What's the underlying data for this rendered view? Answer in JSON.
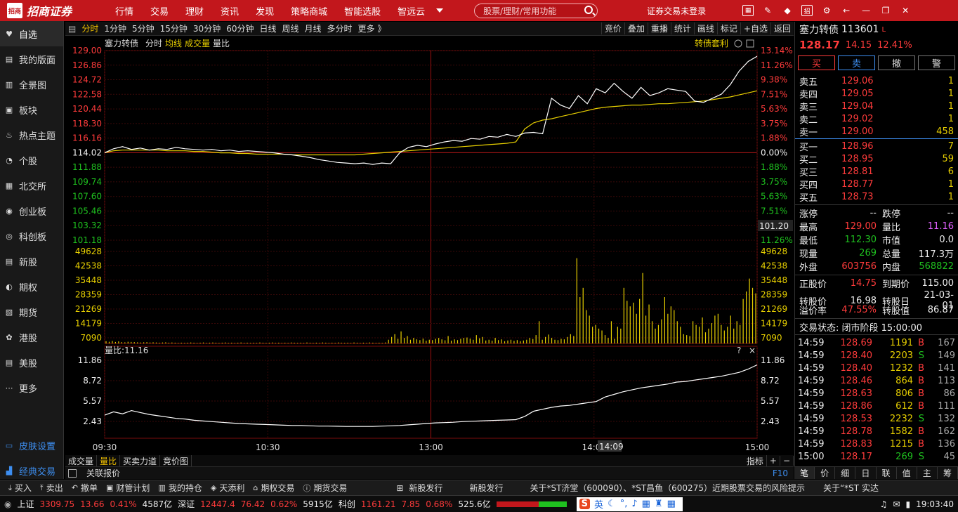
{
  "topbar": {
    "logo_mark": "招商\n证券",
    "logo_text": "招商证券",
    "nav": [
      "行情",
      "交易",
      "理财",
      "资讯",
      "发现",
      "策略商城",
      "智能选股",
      "智远云"
    ],
    "search_placeholder": "股票/理财/常用功能",
    "login_status": "证券交易未登录"
  },
  "sidebar": {
    "items": [
      {
        "label": "自选",
        "icon": "heart-icon"
      },
      {
        "label": "我的版面",
        "icon": "layout-icon"
      },
      {
        "label": "全景图",
        "icon": "panorama-icon"
      },
      {
        "label": "板块",
        "icon": "sector-icon"
      },
      {
        "label": "热点主题",
        "icon": "fire-icon"
      },
      {
        "label": "个股",
        "icon": "stock-icon"
      },
      {
        "label": "北交所",
        "icon": "beijing-exchange-icon"
      },
      {
        "label": "创业板",
        "icon": "chinext-icon"
      },
      {
        "label": "科创板",
        "icon": "star-market-icon"
      },
      {
        "label": "新股",
        "icon": "ipo-icon"
      },
      {
        "label": "期权",
        "icon": "options-icon"
      },
      {
        "label": "期货",
        "icon": "futures-icon"
      },
      {
        "label": "港股",
        "icon": "hk-stock-icon"
      },
      {
        "label": "美股",
        "icon": "us-stock-icon"
      },
      {
        "label": "更多",
        "icon": "more-icon"
      }
    ],
    "skin": "皮肤设置",
    "classic": "经典交易"
  },
  "periodbar": {
    "periods": [
      "分时",
      "1分钟",
      "5分钟",
      "15分钟",
      "30分钟",
      "60分钟",
      "日线",
      "周线",
      "月线",
      "多分时",
      "更多 》"
    ],
    "actions": [
      "竞价",
      "叠加",
      "重播",
      "统计",
      "画线",
      "标记",
      "+自选",
      "返回"
    ]
  },
  "chart_header": {
    "name": "塞力转债",
    "mode": "分时",
    "avg": "均线",
    "vol": "成交量",
    "ratio": "量比",
    "arbitrage": "转债套利",
    "ratio_label": "量比:11.16",
    "price_tag": "101.20",
    "time_tag": "14:09"
  },
  "chart_data": {
    "type": "line",
    "price_axis_left": [
      "129.00",
      "126.86",
      "124.72",
      "122.58",
      "120.44",
      "118.30",
      "116.16",
      "114.02",
      "111.88",
      "109.74",
      "107.60",
      "105.46",
      "103.32",
      "101.18"
    ],
    "pct_axis_right": [
      "13.14%",
      "11.26%",
      "9.38%",
      "7.51%",
      "5.63%",
      "3.75%",
      "1.88%",
      "0.00%",
      "1.88%",
      "3.75%",
      "5.63%",
      "7.51%",
      "9.38%",
      "11.26%"
    ],
    "volume_axis": [
      "49628",
      "42538",
      "35448",
      "28359",
      "21269",
      "14179",
      "7090"
    ],
    "ratio_axis": [
      "11.86",
      "8.72",
      "5.57",
      "2.43"
    ],
    "time_axis": [
      "09:30",
      "10:30",
      "13:00",
      "14:00",
      "15:00"
    ],
    "price_range": [
      99.04,
      129.0
    ],
    "prev_close": 114.02,
    "price_series": [
      114.02,
      114.6,
      114.9,
      114.5,
      114.7,
      114.4,
      114.6,
      114.5,
      114.8,
      114.6,
      114.5,
      114.4,
      114.5,
      114.3,
      114.4,
      114.2,
      114.3,
      114.2,
      114.1,
      114.0,
      113.8,
      113.7,
      113.5,
      113.3,
      113.0,
      112.8,
      112.6,
      112.5,
      112.4,
      112.5,
      112.3,
      112.5,
      112.4,
      114.0,
      114.8,
      115.1,
      114.9,
      115.3,
      115.6,
      115.8,
      115.7,
      116.1,
      116.0,
      116.4,
      116.3,
      116.7,
      116.4,
      116.9,
      117.0,
      116.8,
      122.0,
      121.0,
      120.5,
      122.4,
      121.2,
      123.4,
      122.8,
      124.2,
      123.0,
      122.0,
      123.6,
      122.4,
      122.8,
      123.4,
      123.2,
      123.0,
      121.6,
      121.4,
      122.0,
      122.6,
      124.0,
      126.0,
      127.4,
      128.17
    ],
    "avg_series": [
      114.02,
      114.3,
      114.4,
      114.4,
      114.4,
      114.4,
      114.4,
      114.3,
      114.3,
      114.3,
      114.2,
      114.2,
      114.1,
      114.0,
      114.0,
      113.9,
      113.9,
      113.8,
      113.8,
      113.8,
      113.8,
      113.7,
      113.7,
      113.7,
      113.7,
      113.7,
      113.7,
      113.7,
      113.7,
      113.8,
      113.9,
      114.0,
      114.1,
      114.2,
      114.3,
      114.4,
      114.5,
      114.6,
      114.7,
      114.8,
      114.9,
      115.0,
      115.1,
      115.2,
      115.3,
      115.4,
      115.6,
      117.5,
      118.4,
      118.8,
      119.0,
      119.3,
      119.6,
      119.9,
      120.2,
      120.5,
      120.7,
      120.8,
      120.9,
      121.0,
      121.0,
      121.1,
      121.2,
      121.2,
      121.3,
      121.4,
      121.5,
      121.6,
      121.8,
      122.0,
      122.2,
      122.5,
      122.8,
      123.1
    ],
    "volume_max": 49628,
    "volume_series": [
      1200,
      900,
      1300,
      800,
      1100,
      700,
      600,
      900,
      800,
      700,
      600,
      500,
      600,
      700,
      500,
      600,
      500,
      400,
      500,
      600,
      400,
      500,
      400,
      300,
      400,
      300,
      400,
      500,
      400,
      300,
      400,
      500,
      300,
      400,
      500,
      400,
      300,
      400,
      500,
      300,
      400,
      300,
      400,
      500,
      300,
      400,
      300,
      400,
      300,
      500,
      400,
      300,
      400,
      500,
      300,
      400,
      300,
      400,
      300,
      500,
      400,
      300,
      400,
      300,
      500,
      400,
      300,
      400,
      300,
      500,
      400,
      300,
      400,
      300,
      500,
      400,
      300,
      400,
      300,
      500,
      400,
      300,
      400,
      300,
      500,
      400,
      300,
      400,
      300,
      500,
      2000,
      3500,
      5000,
      2500,
      6500,
      3000,
      4000,
      2000,
      3000,
      2200,
      1800,
      2600,
      1500,
      2000,
      1800,
      2500,
      3000,
      2200,
      1700,
      4000,
      1500,
      2200,
      1800,
      2500,
      3000,
      3200,
      2600,
      2000,
      4500,
      2800,
      3500,
      1600,
      2000,
      1500,
      3000,
      1800,
      2200,
      1200,
      1600,
      2000,
      1400,
      1800,
      1200,
      1600,
      2000,
      3000,
      2400,
      4500,
      12000,
      2000,
      3500,
      4800,
      3000,
      2000,
      1800,
      2500,
      2200,
      3500,
      5000,
      4000,
      46000,
      25000,
      30000,
      18000,
      15000,
      9000,
      10000,
      8000,
      7000,
      4500,
      3000,
      12000,
      2500,
      9000,
      8000,
      30000,
      23000,
      20000,
      22000,
      16000,
      24000,
      38000,
      15000,
      21000,
      12000,
      8000,
      10000,
      13000,
      25000,
      16000,
      20000,
      18000,
      12000,
      9000,
      5000,
      4500,
      4000,
      12000,
      10000,
      9000,
      14000,
      6000,
      8000,
      11000,
      15000,
      16000,
      10000,
      7000,
      9000,
      15000,
      8000,
      12000,
      10000,
      24000,
      28000,
      35000,
      30000,
      27000
    ],
    "ratio_series": [
      3.4,
      3.9,
      3.6,
      4.1,
      3.8,
      3.5,
      3.3,
      3.1,
      2.9,
      2.8,
      2.6,
      2.5,
      2.4,
      2.3,
      2.2,
      2.1,
      2.05,
      2.0,
      1.95,
      1.9,
      1.85,
      1.8,
      1.8,
      1.75,
      1.7,
      1.7,
      1.68,
      1.65,
      1.65,
      1.65,
      1.65,
      1.7,
      1.75,
      1.8,
      1.9,
      2.0,
      2.1,
      2.2,
      2.25,
      2.3,
      2.4,
      2.45,
      2.5,
      2.55,
      2.6,
      2.65,
      2.7,
      3.2,
      4.0,
      4.3,
      4.6,
      4.8,
      4.9,
      5.1,
      5.3,
      5.5,
      6.2,
      6.6,
      7.0,
      7.3,
      7.6,
      7.8,
      8.0,
      8.2,
      8.5,
      8.6,
      8.8,
      9.0,
      9.2,
      9.4,
      9.7,
      10.0,
      10.5,
      11.16
    ]
  },
  "subtabs": [
    "成交量",
    "量比",
    "买卖力道",
    "竞价图"
  ],
  "linkbar": {
    "label": "关联报价",
    "key": "F10",
    "chart_controls": [
      "指标",
      "+",
      "−"
    ]
  },
  "quote": {
    "name": "塞力转债",
    "code": "113601",
    "flag": "L",
    "price": "128.17",
    "change": "14.15",
    "pct": "12.41%",
    "buttons": [
      "买",
      "卖",
      "撤",
      "警"
    ],
    "asks": [
      {
        "label": "卖五",
        "price": "129.06",
        "vol": "1"
      },
      {
        "label": "卖四",
        "price": "129.05",
        "vol": "1"
      },
      {
        "label": "卖三",
        "price": "129.04",
        "vol": "1"
      },
      {
        "label": "卖二",
        "price": "129.02",
        "vol": "1"
      },
      {
        "label": "卖一",
        "price": "129.00",
        "vol": "458"
      }
    ],
    "bids": [
      {
        "label": "买一",
        "price": "128.96",
        "vol": "7"
      },
      {
        "label": "买二",
        "price": "128.95",
        "vol": "59"
      },
      {
        "label": "买三",
        "price": "128.81",
        "vol": "6"
      },
      {
        "label": "买四",
        "price": "128.77",
        "vol": "1"
      },
      {
        "label": "买五",
        "price": "128.73",
        "vol": "1"
      }
    ],
    "stats": [
      {
        "l1": "涨停",
        "v1": "--",
        "c1": "white",
        "l2": "跌停",
        "v2": "--",
        "c2": "white"
      },
      {
        "l1": "最高",
        "v1": "129.00",
        "c1": "red",
        "l2": "量比",
        "v2": "11.16",
        "c2": "magenta"
      },
      {
        "l1": "最低",
        "v1": "112.30",
        "c1": "green",
        "l2": "市值",
        "v2": "0.0",
        "c2": "white"
      },
      {
        "l1": "现量",
        "v1": "269",
        "c1": "green",
        "l2": "总量",
        "v2": "117.3万",
        "c2": "white"
      },
      {
        "l1": "外盘",
        "v1": "603756",
        "c1": "red",
        "l2": "内盘",
        "v2": "568822",
        "c2": "green"
      }
    ],
    "bond": [
      {
        "l1": "正股价",
        "v1": "14.75",
        "c1": "red",
        "l2": "到期价",
        "v2": "115.00",
        "c2": "white"
      },
      {
        "l1": "转股价",
        "v1": "16.98",
        "c1": "white",
        "l2": "转股日",
        "v2": "21-03-01",
        "c2": "white"
      },
      {
        "l1": "溢价率",
        "v1": "47.55%",
        "c1": "red",
        "l2": "转股值",
        "v2": "86.87",
        "c2": "white"
      }
    ],
    "status": "交易状态: 闭市阶段 15:00:00",
    "ticks": [
      {
        "t": "14:59",
        "p": "128.69",
        "v": "1191",
        "s": "B",
        "n": "167",
        "pc": "red",
        "vc": "yellow",
        "sc": "red"
      },
      {
        "t": "14:59",
        "p": "128.40",
        "v": "2203",
        "s": "S",
        "n": "149",
        "pc": "red",
        "vc": "yellow",
        "sc": "green"
      },
      {
        "t": "14:59",
        "p": "128.40",
        "v": "1232",
        "s": "B",
        "n": "141",
        "pc": "red",
        "vc": "yellow",
        "sc": "red"
      },
      {
        "t": "14:59",
        "p": "128.46",
        "v": "864",
        "s": "B",
        "n": "113",
        "pc": "red",
        "vc": "yellow",
        "sc": "red"
      },
      {
        "t": "14:59",
        "p": "128.63",
        "v": "806",
        "s": "B",
        "n": "86",
        "pc": "red",
        "vc": "yellow",
        "sc": "red"
      },
      {
        "t": "14:59",
        "p": "128.86",
        "v": "612",
        "s": "B",
        "n": "111",
        "pc": "red",
        "vc": "yellow",
        "sc": "red"
      },
      {
        "t": "14:59",
        "p": "128.53",
        "v": "2232",
        "s": "S",
        "n": "132",
        "pc": "red",
        "vc": "yellow",
        "sc": "green"
      },
      {
        "t": "14:59",
        "p": "128.78",
        "v": "1582",
        "s": "B",
        "n": "162",
        "pc": "red",
        "vc": "yellow",
        "sc": "red"
      },
      {
        "t": "14:59",
        "p": "128.83",
        "v": "1215",
        "s": "B",
        "n": "136",
        "pc": "red",
        "vc": "yellow",
        "sc": "red"
      },
      {
        "t": "15:00",
        "p": "128.17",
        "v": "269",
        "s": "S",
        "n": "45",
        "pc": "red",
        "vc": "green",
        "sc": "green"
      }
    ],
    "tabs": [
      "笔",
      "价",
      "细",
      "日",
      "联",
      "值",
      "主",
      "筹"
    ]
  },
  "tradebar": {
    "buttons": [
      "买入",
      "卖出",
      "撤单",
      "财管计划",
      "我的持仓",
      "天添利",
      "期权交易",
      "期货交易"
    ],
    "news": [
      "新股发行",
      "新股发行",
      "关于*ST济堂（600090）、*ST昌鱼（600275）近期股票交易的风险提示",
      "关于“*ST 实达"
    ]
  },
  "indexbar": {
    "sh_label": "上证",
    "sh_val": "3309.75",
    "sh_chg": "13.66",
    "sh_pct": "0.41%",
    "sh_amt": "4587亿",
    "sz_label": "深证",
    "sz_val": "12447.4",
    "sz_chg": "76.42",
    "sz_pct": "0.62%",
    "sz_amt": "5915亿",
    "kc_label": "科创",
    "kc_val": "1161.21",
    "kc_chg": "7.85",
    "kc_pct": "0.68%",
    "kc_amt": "525.6亿",
    "ime": "英",
    "clock": "19:03:40"
  },
  "colors": {
    "up": "#ff3b3b",
    "down": "#1fc11f",
    "accent": "#c2171c",
    "volume": "#e8d000",
    "avg": "#e8d000",
    "price_line": "#ffffff"
  }
}
